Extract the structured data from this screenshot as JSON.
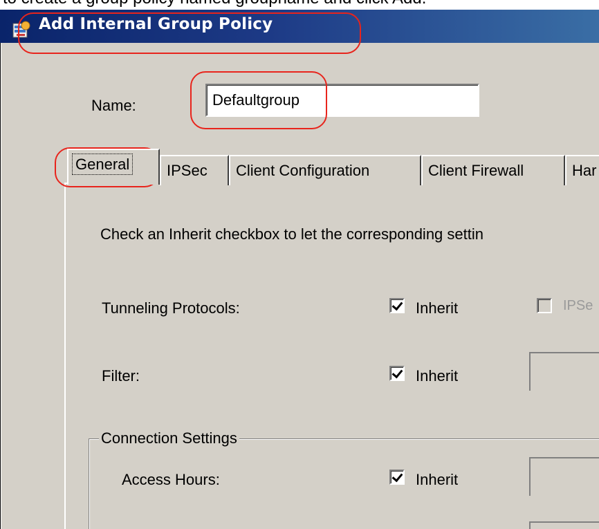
{
  "caption": {
    "text": "to create a group policy named groupname and click Add."
  },
  "window": {
    "title": "Add Internal Group Policy",
    "icon": "group-policy-app-icon"
  },
  "name_field": {
    "label": "Name:",
    "value": "Defaultgroup"
  },
  "tabs": [
    {
      "label": "General",
      "active": true
    },
    {
      "label": "IPSec",
      "active": false
    },
    {
      "label": "Client Configuration",
      "active": false
    },
    {
      "label": "Client Firewall",
      "active": false
    },
    {
      "label": "Har",
      "active": false
    }
  ],
  "general": {
    "instruction": "Check an Inherit checkbox to let the corresponding settin",
    "rows": [
      {
        "label": "Tunneling Protocols:",
        "inherit_label": "Inherit",
        "inherit_checked": true,
        "extra_label": "IPSe",
        "extra_checked": false,
        "extra_disabled": true
      },
      {
        "label": "Filter:",
        "inherit_label": "Inherit",
        "inherit_checked": true
      }
    ],
    "connection_settings": {
      "title": "Connection Settings",
      "rows": [
        {
          "label": "Access Hours:",
          "inherit_label": "Inherit",
          "inherit_checked": true
        }
      ]
    }
  },
  "colors": {
    "dialog_bg": "#d4d0c8",
    "titlebar_start": "#0a246a",
    "titlebar_end": "#3a6ea5",
    "annotation": "#e8241c"
  }
}
